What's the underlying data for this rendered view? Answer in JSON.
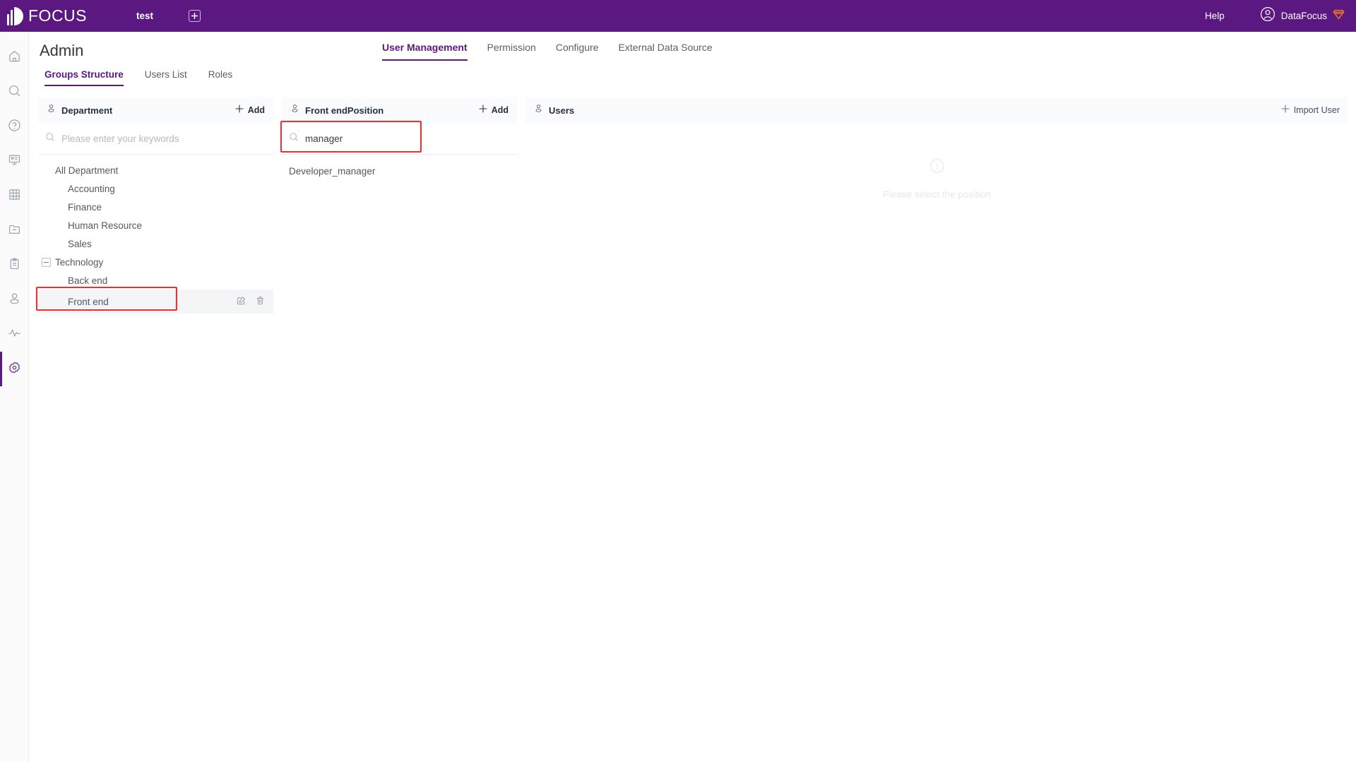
{
  "topbar": {
    "brand": "FOCUS",
    "workspace_tab": "test",
    "new_tab_icon": "plus-square-icon",
    "help_label": "Help",
    "user_name": "DataFocus",
    "user_avatar_icon": "user-circle-icon",
    "gem_icon": "gem-icon",
    "bg_color": "#5B1880"
  },
  "rail": {
    "items": [
      {
        "icon": "home-icon",
        "active": false
      },
      {
        "icon": "search-icon",
        "active": false
      },
      {
        "icon": "question-circle-icon",
        "active": false
      },
      {
        "icon": "presentation-icon",
        "active": false
      },
      {
        "icon": "table-grid-icon",
        "active": false
      },
      {
        "icon": "folder-minus-icon",
        "active": false
      },
      {
        "icon": "clipboard-icon",
        "active": false
      },
      {
        "icon": "user-icon",
        "active": false
      },
      {
        "icon": "activity-pulse-icon",
        "active": false
      },
      {
        "icon": "gear-icon",
        "active": true
      }
    ]
  },
  "page": {
    "title": "Admin",
    "top_tabs": [
      {
        "label": "User Management",
        "active": true
      },
      {
        "label": "Permission",
        "active": false
      },
      {
        "label": "Configure",
        "active": false
      },
      {
        "label": "External Data Source",
        "active": false
      }
    ],
    "sub_tabs": [
      {
        "label": "Groups Structure",
        "active": true
      },
      {
        "label": "Users List",
        "active": false
      },
      {
        "label": "Roles",
        "active": false
      }
    ]
  },
  "department_panel": {
    "icon": "user-outline-icon",
    "title": "Department",
    "add_label": "Add",
    "add_icon": "plus-icon",
    "search": {
      "icon": "search-icon",
      "value": "",
      "placeholder": "Please enter your keywords"
    },
    "tree": [
      {
        "label": "All Department",
        "indent": 1,
        "expander": false,
        "selected": false
      },
      {
        "label": "Accounting",
        "indent": 2,
        "expander": false,
        "selected": false
      },
      {
        "label": "Finance",
        "indent": 2,
        "expander": false,
        "selected": false
      },
      {
        "label": "Human Resource",
        "indent": 2,
        "expander": false,
        "selected": false
      },
      {
        "label": "Sales",
        "indent": 2,
        "expander": false,
        "selected": false
      },
      {
        "label": "Technology",
        "indent": 1,
        "expander": true,
        "selected": false
      },
      {
        "label": "Back end",
        "indent": 2,
        "expander": false,
        "selected": false
      },
      {
        "label": "Front end",
        "indent": 2,
        "expander": false,
        "selected": true,
        "actions": [
          "edit-icon",
          "delete-icon"
        ]
      }
    ]
  },
  "position_panel": {
    "icon": "user-outline-icon",
    "title": "Front endPosition",
    "add_label": "Add",
    "add_icon": "plus-icon",
    "search": {
      "icon": "search-icon",
      "value": "manager",
      "placeholder": "Please enter your keywords"
    },
    "items": [
      {
        "label": "Developer_manager"
      }
    ]
  },
  "users_panel": {
    "icon": "user-outline-icon",
    "title": "Users",
    "import_label": "Import User",
    "import_icon": "plus-icon",
    "empty_icon": "exclamation-circle-icon",
    "empty_text": "Please select the position"
  },
  "highlights": {
    "color": "#FB2B2B",
    "regions": [
      "position-search-input",
      "department-tree-front-end"
    ]
  }
}
